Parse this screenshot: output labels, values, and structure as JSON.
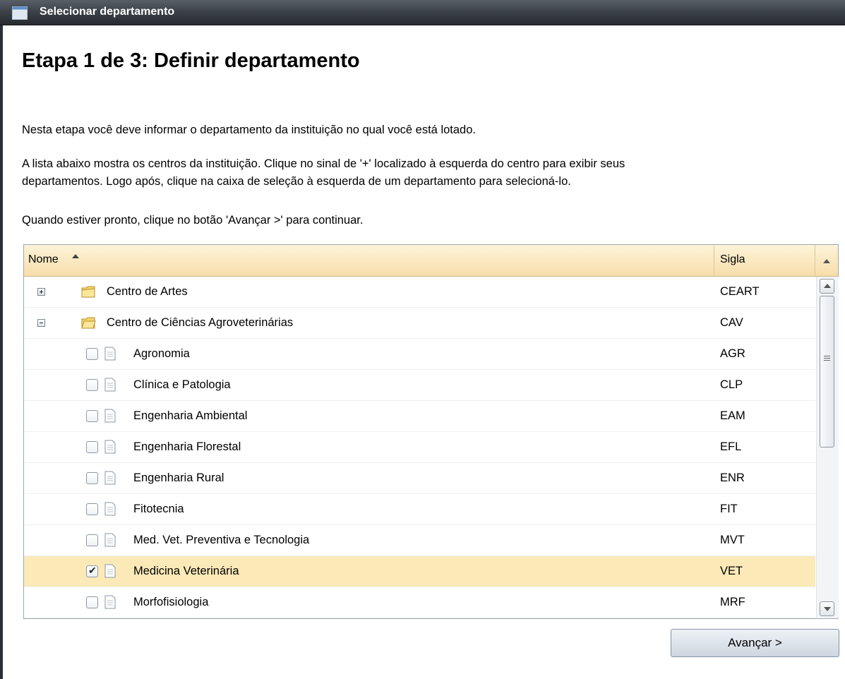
{
  "window": {
    "title": "Selecionar departamento"
  },
  "page": {
    "heading": "Etapa 1 de 3: Definir departamento",
    "intro": "Nesta etapa você deve informar o departamento da instituição no qual você está lotado.",
    "instructions_line1": "A lista abaixo mostra os centros da instituição. Clique no sinal de '+' localizado à esquerda do centro para exibir seus",
    "instructions_line2": "departamentos. Logo após, clique na caixa de seleção à esquerda de um departamento para selecioná-lo.",
    "proceed_hint": "Quando estiver pronto, clique no botão 'Avançar >' para continuar."
  },
  "grid": {
    "columns": {
      "name": "Nome",
      "code": "Sigla"
    },
    "sort": {
      "column": "Nome",
      "direction": "ascending"
    },
    "rows": [
      {
        "type": "center",
        "expanded": false,
        "name": "Centro de Artes",
        "code": "CEART"
      },
      {
        "type": "center",
        "expanded": true,
        "name": "Centro de Ciências Agroveterinárias",
        "code": "CAV"
      },
      {
        "type": "department",
        "checked": false,
        "name": "Agronomia",
        "code": "AGR"
      },
      {
        "type": "department",
        "checked": false,
        "name": "Clínica e Patologia",
        "code": "CLP"
      },
      {
        "type": "department",
        "checked": false,
        "name": "Engenharia Ambiental",
        "code": "EAM"
      },
      {
        "type": "department",
        "checked": false,
        "name": "Engenharia Florestal",
        "code": "EFL"
      },
      {
        "type": "department",
        "checked": false,
        "name": "Engenharia Rural",
        "code": "ENR"
      },
      {
        "type": "department",
        "checked": false,
        "name": "Fitotecnia",
        "code": "FIT"
      },
      {
        "type": "department",
        "checked": false,
        "name": "Med. Vet. Preventiva e Tecnologia",
        "code": "MVT"
      },
      {
        "type": "department",
        "checked": true,
        "name": "Medicina Veterinária",
        "code": "VET"
      },
      {
        "type": "department",
        "checked": false,
        "name": "Morfofisiologia",
        "code": "MRF"
      }
    ],
    "selected_row_color": "#fbeab8",
    "header_color": "#f7deaa"
  },
  "buttons": {
    "next": "Avançar >"
  }
}
